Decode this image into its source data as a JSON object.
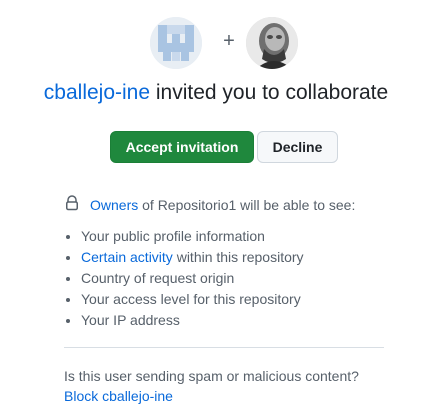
{
  "avatars": {
    "inviter": {
      "alt": "cballejo-ine",
      "icon": "identicon-avatar"
    },
    "invitee": {
      "alt": "user avatar",
      "icon": "user-photo-avatar"
    },
    "joiner": "+"
  },
  "title": {
    "username": "cballejo-ine",
    "text": " invited you to collaborate"
  },
  "actions": {
    "accept_label": "Accept invitation",
    "decline_label": "Decline"
  },
  "owners_notice": {
    "link_label": "Owners",
    "text": " of Repositorio1 will be able to see:"
  },
  "permissions": [
    {
      "text": "Your public profile information"
    },
    {
      "link": "Certain activity",
      "text": " within this repository"
    },
    {
      "text": "Country of request origin"
    },
    {
      "text": "Your access level for this repository"
    },
    {
      "text": "Your IP address"
    }
  ],
  "spam": {
    "question": "Is this user sending spam or malicious content?",
    "block_label": "Block cballejo-ine"
  },
  "colors": {
    "accent_link": "#0969da",
    "accept_bg": "#1f883d",
    "text": "#1f2328",
    "muted": "#57606a"
  }
}
